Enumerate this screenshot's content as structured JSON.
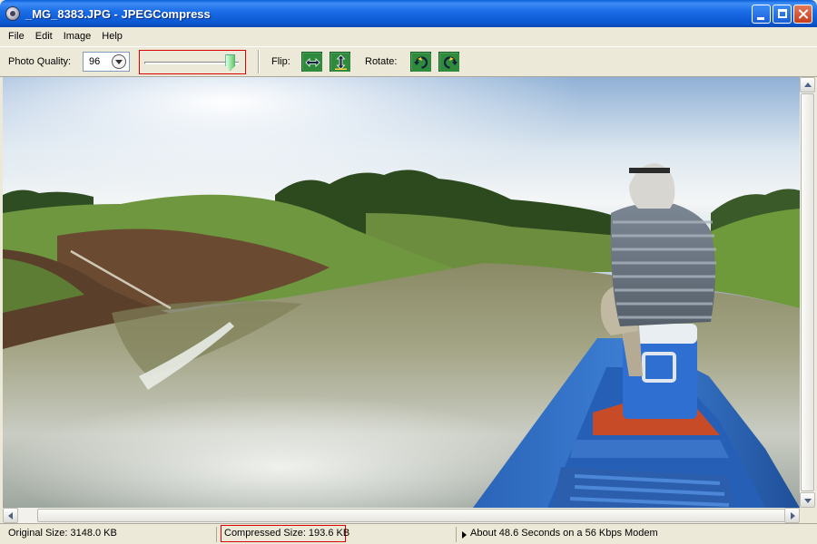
{
  "window": {
    "title": "_MG_8383.JPG - JPEGCompress"
  },
  "menu": [
    {
      "label": "File"
    },
    {
      "label": "Edit"
    },
    {
      "label": "Image"
    },
    {
      "label": "Help"
    }
  ],
  "toolbar": {
    "quality_label": "Photo Quality:",
    "quality_value": "96",
    "quality_level_percent": 96,
    "flip_label": "Flip:",
    "rotate_label": "Rotate:"
  },
  "status": {
    "original_size": "Original Size: 3148.0 KB",
    "compressed_size": "Compressed Size: 193.6 KB",
    "modem_time": "About 48.6 Seconds on a 56 Kbps Modem"
  },
  "colors": {
    "highlight_border": "#dd0000",
    "tool_button_green": "#4ca35a",
    "titlebar_blue": "#1c6ee8"
  },
  "icons": {
    "flip_horizontal": "flip-horizontal-icon",
    "flip_vertical": "flip-vertical-icon",
    "rotate_left": "rotate-left-icon",
    "rotate_right": "rotate-right-icon"
  }
}
